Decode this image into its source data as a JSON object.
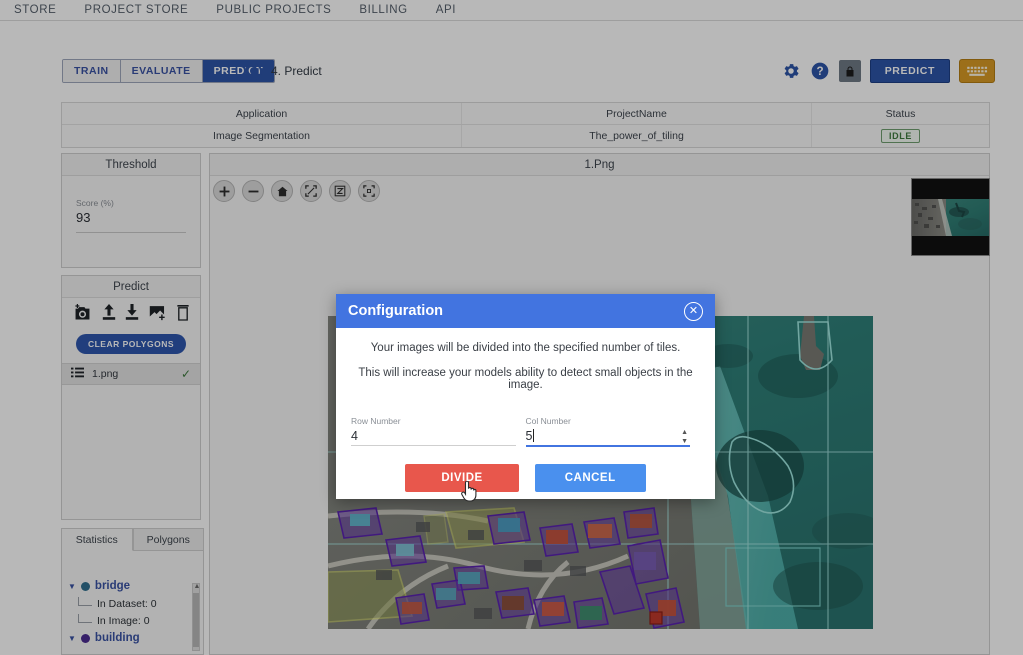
{
  "topnav": {
    "items": [
      {
        "label": "STORE",
        "name": "nav-store"
      },
      {
        "label": "PROJECT STORE",
        "name": "nav-project-store"
      },
      {
        "label": "PUBLIC PROJECTS",
        "name": "nav-public-projects"
      },
      {
        "label": "BILLING",
        "name": "nav-billing"
      },
      {
        "label": "API",
        "name": "nav-api"
      }
    ]
  },
  "actionbar": {
    "segments": [
      {
        "label": "TRAIN",
        "active": false
      },
      {
        "label": "EVALUATE",
        "active": false
      },
      {
        "label": "PREDICT",
        "active": true
      }
    ],
    "step_label": "4. Predict",
    "settings_icon": "gear-icon",
    "help_icon": "question-circle-icon",
    "lock_icon": "lock-icon",
    "predict_label": "PREDICT",
    "keyboard_icon": "keyboard-icon"
  },
  "infotable": {
    "headers": [
      "Application",
      "ProjectName",
      "Status"
    ],
    "row": {
      "application": "Image Segmentation",
      "project_name": "The_power_of_tiling",
      "status": "IDLE"
    }
  },
  "threshold": {
    "title": "Threshold",
    "score_label": "Score (%)",
    "score_value": "93"
  },
  "predict_panel": {
    "title": "Predict",
    "icons": [
      {
        "name": "add-screenshot-icon",
        "glyph": "὏7"
      },
      {
        "name": "upload-icon"
      },
      {
        "name": "download-icon"
      },
      {
        "name": "add-image-icon"
      },
      {
        "name": "trash-icon"
      }
    ],
    "clear_polygons_label": "CLEAR POLYGONS",
    "files": [
      {
        "name": "1.png",
        "selected": true,
        "check": "✓"
      }
    ]
  },
  "stats_panel": {
    "tabs": [
      {
        "label": "Statistics",
        "active": true
      },
      {
        "label": "Polygons",
        "active": false
      }
    ],
    "tree": [
      {
        "label": "bridge",
        "color": "#31708f",
        "children": [
          "In Dataset: 0",
          "In Image: 0"
        ]
      },
      {
        "label": "building",
        "color": "#4b2c91",
        "children": []
      }
    ]
  },
  "viewer": {
    "title": "1.Png",
    "toolbar": [
      {
        "name": "zoom-in-icon",
        "glyph": "+"
      },
      {
        "name": "zoom-out-icon",
        "glyph": "−"
      },
      {
        "name": "home-icon",
        "glyph": "⌂"
      },
      {
        "name": "fit-screen-icon",
        "glyph": "⛶"
      },
      {
        "name": "rotate-icon",
        "glyph": "Z"
      },
      {
        "name": "expand-icon",
        "glyph": "⤢"
      }
    ]
  },
  "modal": {
    "title": "Configuration",
    "close_icon": "close-icon",
    "line1": "Your images will be divided into the specified number of tiles.",
    "line2": "This will increase your models ability to detect small objects in the image.",
    "row_label": "Row Number",
    "row_value": "4",
    "col_label": "Col Number",
    "col_value": "5",
    "divide_label": "DIVIDE",
    "cancel_label": "CANCEL"
  },
  "colors": {
    "accent_blue": "#2d55a8",
    "modal_header": "#4274e0",
    "divide_red": "#e8574c",
    "cancel_blue": "#4a90ee",
    "keyboard_gold": "#d99a24",
    "idle_green": "#3f7a3f"
  }
}
